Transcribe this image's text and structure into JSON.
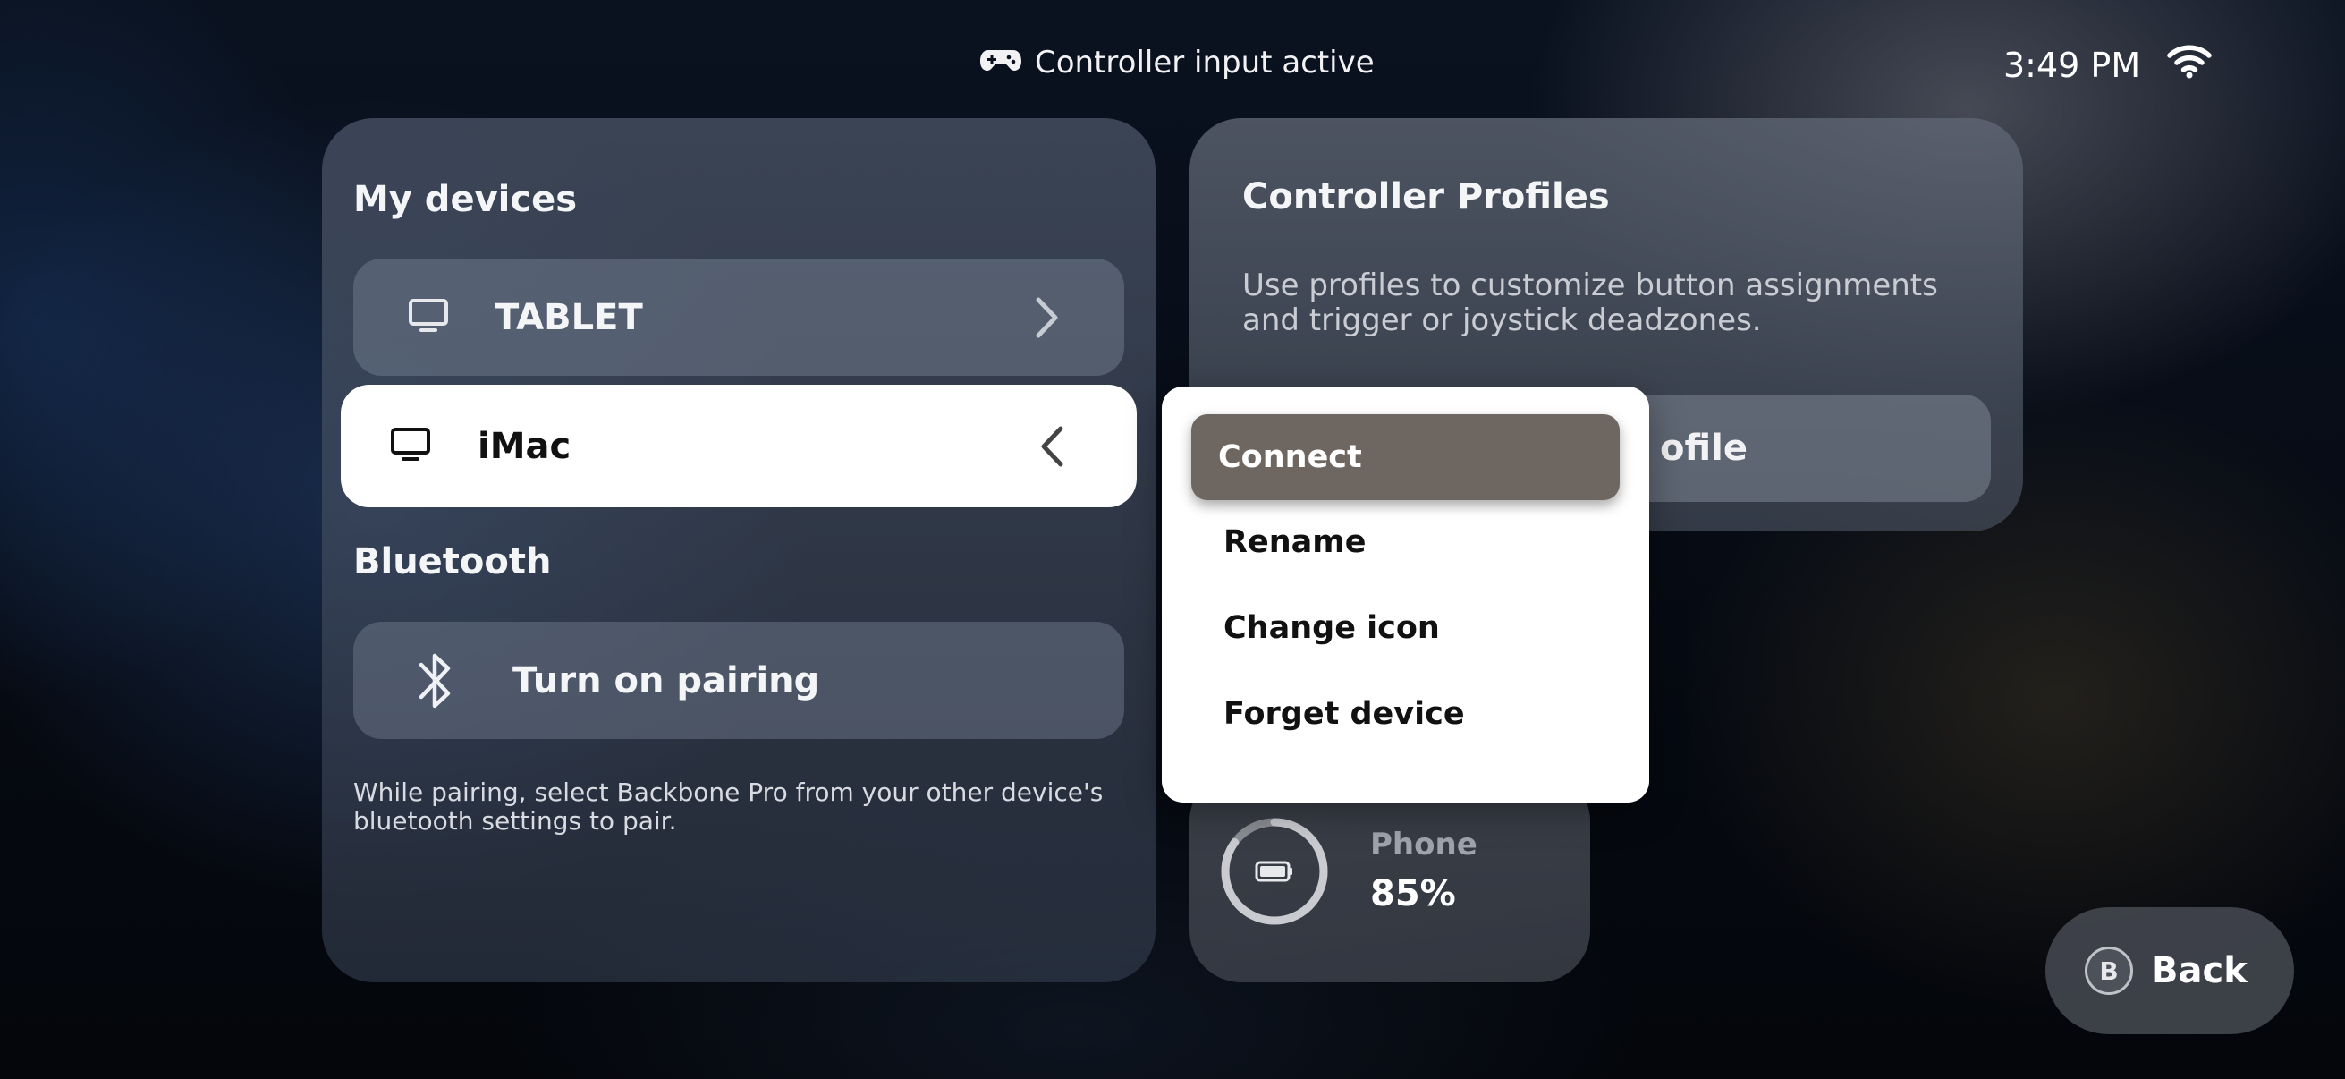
{
  "status_bar": {
    "input_status": "Controller input active",
    "time": "3:49 PM",
    "icons": [
      "gamepad-icon",
      "wifi-icon"
    ]
  },
  "devices_panel": {
    "title": "My devices",
    "devices": [
      {
        "name": "TABLET",
        "icon": "monitor-icon",
        "state": "collapsed"
      },
      {
        "name": "iMac",
        "icon": "monitor-icon",
        "state": "expanded"
      }
    ],
    "bluetooth": {
      "title": "Bluetooth",
      "pairing_label": "Turn on pairing",
      "help_text": "While pairing, select Backbone Pro from your other device's bluetooth settings to pair."
    }
  },
  "profiles_panel": {
    "title": "Controller Profiles",
    "description": "Use profiles to customize button assignments and trigger or joystick deadzones.",
    "button_label_visible": "ofile"
  },
  "context_menu": {
    "items": [
      "Connect",
      "Rename",
      "Change icon",
      "Forget device"
    ],
    "selected": "Connect"
  },
  "battery": {
    "device": "Phone",
    "level_text": "85%",
    "level": 0.85
  },
  "back_button": {
    "glyph": "B",
    "label": "Back"
  }
}
